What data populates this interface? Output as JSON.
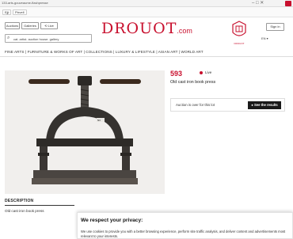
{
  "browser": {
    "url": "133-arts-gouveaume-flashpresse",
    "controls": "–  □  ✕",
    "bookmarks": [
      "Ejji",
      "Pixvell"
    ]
  },
  "header": {
    "auctions_label": "Auctions",
    "galleries_label": "Galleries",
    "live_label": "Live",
    "search_text": "cat. artist. auction house. gallery",
    "logo_main": "DROUOT",
    "logo_suffix": ".com",
    "crest_text": "DROUOT",
    "lang": "EN ▾",
    "signin_label": "Sign in"
  },
  "nav": {
    "items": "FINE ARTS  |  FURNITURE & WORKS OF ART  |  COLLECTIONS  |  LUXURY & LIFESTYLE  |  ASIAN ART  |  WORLD ART"
  },
  "lot": {
    "number": "593",
    "status_live": "Live",
    "title": "Old cast iron book press",
    "status_text": "Auction is over for this lot",
    "see_results": "See the results",
    "image_tag": "N0"
  },
  "description": {
    "heading": "DESCRIPTION",
    "text": "Old cast iron book press"
  },
  "cookie": {
    "title": "We respect your privacy:",
    "body": "We use cookies to provide you with a better browsing experience, perform site traffic analysis, and deliver content and advertisements most relevant to your interests."
  },
  "colors": {
    "brand": "#c8102e",
    "button_dark": "#1a1a1a"
  }
}
